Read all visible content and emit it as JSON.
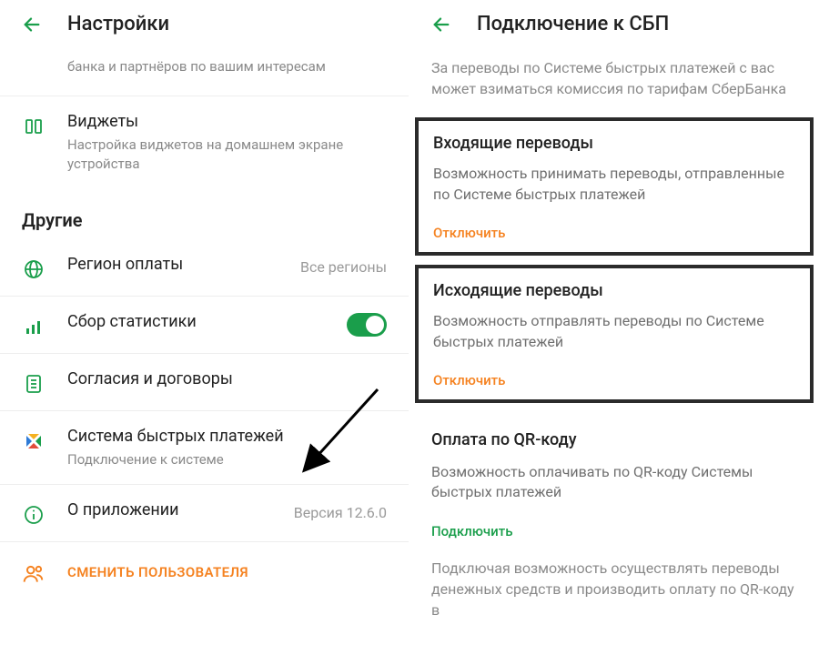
{
  "left": {
    "title": "Настройки",
    "top_row": {
      "title": "",
      "sub": "банка и партнёров по вашим интересам"
    },
    "widgets": {
      "title": "Виджеты",
      "sub": "Настройка виджетов на домашнем экране устройства"
    },
    "section": "Другие",
    "region": {
      "title": "Регион оплаты",
      "trail": "Все регионы"
    },
    "stats": {
      "title": "Сбор статистики"
    },
    "consents": {
      "title": "Согласия и договоры"
    },
    "sbp": {
      "title": "Система быстрых платежей",
      "sub": "Подключение к системе"
    },
    "about": {
      "title": "О приложении",
      "trail": "Версия 12.6.0"
    },
    "switch_user": "СМЕНИТЬ ПОЛЬЗОВАТЕЛЯ"
  },
  "right": {
    "title": "Подключение к СБП",
    "intro": "За переводы по Системе быстрых платежей с вас может взиматься комиссия по тарифам СберБанка",
    "incoming": {
      "title": "Входящие переводы",
      "body": "Возможность принимать переводы, отправленные по Системе быстрых платежей",
      "action": "Отключить"
    },
    "outgoing": {
      "title": "Исходящие переводы",
      "body": "Возможность отправлять переводы по Системе быстрых платежей",
      "action": "Отключить"
    },
    "qr": {
      "title": "Оплата по QR-коду",
      "body": "Возможность оплачивать по QR-коду Системы быстрых платежей",
      "action": "Подключить"
    },
    "footnote": "Подключая возможность осуществлять переводы денежных средств и производить оплату по QR-коду в"
  }
}
